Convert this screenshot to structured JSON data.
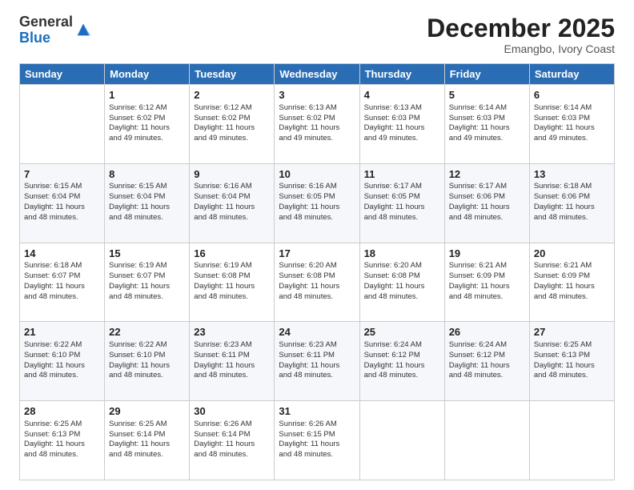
{
  "logo": {
    "general": "General",
    "blue": "Blue"
  },
  "title": "December 2025",
  "subtitle": "Emangbo, Ivory Coast",
  "weekdays": [
    "Sunday",
    "Monday",
    "Tuesday",
    "Wednesday",
    "Thursday",
    "Friday",
    "Saturday"
  ],
  "weeks": [
    [
      {
        "day": "",
        "info": ""
      },
      {
        "day": "1",
        "info": "Sunrise: 6:12 AM\nSunset: 6:02 PM\nDaylight: 11 hours\nand 49 minutes."
      },
      {
        "day": "2",
        "info": "Sunrise: 6:12 AM\nSunset: 6:02 PM\nDaylight: 11 hours\nand 49 minutes."
      },
      {
        "day": "3",
        "info": "Sunrise: 6:13 AM\nSunset: 6:02 PM\nDaylight: 11 hours\nand 49 minutes."
      },
      {
        "day": "4",
        "info": "Sunrise: 6:13 AM\nSunset: 6:03 PM\nDaylight: 11 hours\nand 49 minutes."
      },
      {
        "day": "5",
        "info": "Sunrise: 6:14 AM\nSunset: 6:03 PM\nDaylight: 11 hours\nand 49 minutes."
      },
      {
        "day": "6",
        "info": "Sunrise: 6:14 AM\nSunset: 6:03 PM\nDaylight: 11 hours\nand 49 minutes."
      }
    ],
    [
      {
        "day": "7",
        "info": "Sunrise: 6:15 AM\nSunset: 6:04 PM\nDaylight: 11 hours\nand 48 minutes."
      },
      {
        "day": "8",
        "info": "Sunrise: 6:15 AM\nSunset: 6:04 PM\nDaylight: 11 hours\nand 48 minutes."
      },
      {
        "day": "9",
        "info": "Sunrise: 6:16 AM\nSunset: 6:04 PM\nDaylight: 11 hours\nand 48 minutes."
      },
      {
        "day": "10",
        "info": "Sunrise: 6:16 AM\nSunset: 6:05 PM\nDaylight: 11 hours\nand 48 minutes."
      },
      {
        "day": "11",
        "info": "Sunrise: 6:17 AM\nSunset: 6:05 PM\nDaylight: 11 hours\nand 48 minutes."
      },
      {
        "day": "12",
        "info": "Sunrise: 6:17 AM\nSunset: 6:06 PM\nDaylight: 11 hours\nand 48 minutes."
      },
      {
        "day": "13",
        "info": "Sunrise: 6:18 AM\nSunset: 6:06 PM\nDaylight: 11 hours\nand 48 minutes."
      }
    ],
    [
      {
        "day": "14",
        "info": "Sunrise: 6:18 AM\nSunset: 6:07 PM\nDaylight: 11 hours\nand 48 minutes."
      },
      {
        "day": "15",
        "info": "Sunrise: 6:19 AM\nSunset: 6:07 PM\nDaylight: 11 hours\nand 48 minutes."
      },
      {
        "day": "16",
        "info": "Sunrise: 6:19 AM\nSunset: 6:08 PM\nDaylight: 11 hours\nand 48 minutes."
      },
      {
        "day": "17",
        "info": "Sunrise: 6:20 AM\nSunset: 6:08 PM\nDaylight: 11 hours\nand 48 minutes."
      },
      {
        "day": "18",
        "info": "Sunrise: 6:20 AM\nSunset: 6:08 PM\nDaylight: 11 hours\nand 48 minutes."
      },
      {
        "day": "19",
        "info": "Sunrise: 6:21 AM\nSunset: 6:09 PM\nDaylight: 11 hours\nand 48 minutes."
      },
      {
        "day": "20",
        "info": "Sunrise: 6:21 AM\nSunset: 6:09 PM\nDaylight: 11 hours\nand 48 minutes."
      }
    ],
    [
      {
        "day": "21",
        "info": "Sunrise: 6:22 AM\nSunset: 6:10 PM\nDaylight: 11 hours\nand 48 minutes."
      },
      {
        "day": "22",
        "info": "Sunrise: 6:22 AM\nSunset: 6:10 PM\nDaylight: 11 hours\nand 48 minutes."
      },
      {
        "day": "23",
        "info": "Sunrise: 6:23 AM\nSunset: 6:11 PM\nDaylight: 11 hours\nand 48 minutes."
      },
      {
        "day": "24",
        "info": "Sunrise: 6:23 AM\nSunset: 6:11 PM\nDaylight: 11 hours\nand 48 minutes."
      },
      {
        "day": "25",
        "info": "Sunrise: 6:24 AM\nSunset: 6:12 PM\nDaylight: 11 hours\nand 48 minutes."
      },
      {
        "day": "26",
        "info": "Sunrise: 6:24 AM\nSunset: 6:12 PM\nDaylight: 11 hours\nand 48 minutes."
      },
      {
        "day": "27",
        "info": "Sunrise: 6:25 AM\nSunset: 6:13 PM\nDaylight: 11 hours\nand 48 minutes."
      }
    ],
    [
      {
        "day": "28",
        "info": "Sunrise: 6:25 AM\nSunset: 6:13 PM\nDaylight: 11 hours\nand 48 minutes."
      },
      {
        "day": "29",
        "info": "Sunrise: 6:25 AM\nSunset: 6:14 PM\nDaylight: 11 hours\nand 48 minutes."
      },
      {
        "day": "30",
        "info": "Sunrise: 6:26 AM\nSunset: 6:14 PM\nDaylight: 11 hours\nand 48 minutes."
      },
      {
        "day": "31",
        "info": "Sunrise: 6:26 AM\nSunset: 6:15 PM\nDaylight: 11 hours\nand 48 minutes."
      },
      {
        "day": "",
        "info": ""
      },
      {
        "day": "",
        "info": ""
      },
      {
        "day": "",
        "info": ""
      }
    ]
  ]
}
